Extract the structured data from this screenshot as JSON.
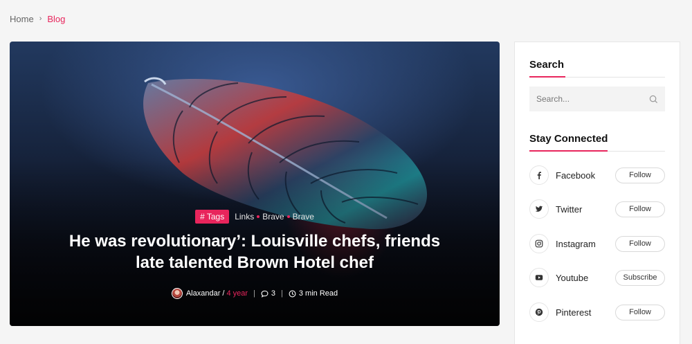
{
  "breadcrumb": {
    "home": "Home",
    "separator": "›",
    "current": "Blog"
  },
  "hero": {
    "tag_badge": "# Tags",
    "tags": [
      "Links",
      "Brave",
      "Brave"
    ],
    "title_line1": "He was revolutionary’: Louisville chefs, friends",
    "title_line2": "late talented Brown Hotel chef",
    "author": "Alaxandar",
    "author_separator": "/",
    "time": "4 year",
    "comments": "3",
    "read_time": "3 min Read"
  },
  "sidebar": {
    "search": {
      "title": "Search",
      "placeholder": "Search..."
    },
    "connected": {
      "title": "Stay Connected",
      "items": [
        {
          "name": "Facebook",
          "action": "Follow",
          "icon": "facebook-icon"
        },
        {
          "name": "Twitter",
          "action": "Follow",
          "icon": "twitter-icon"
        },
        {
          "name": "Instagram",
          "action": "Follow",
          "icon": "instagram-icon"
        },
        {
          "name": "Youtube",
          "action": "Subscribe",
          "icon": "youtube-icon"
        },
        {
          "name": "Pinterest",
          "action": "Follow",
          "icon": "pinterest-icon"
        }
      ]
    }
  },
  "colors": {
    "accent": "#e8255c",
    "background": "#f5f5f5"
  }
}
